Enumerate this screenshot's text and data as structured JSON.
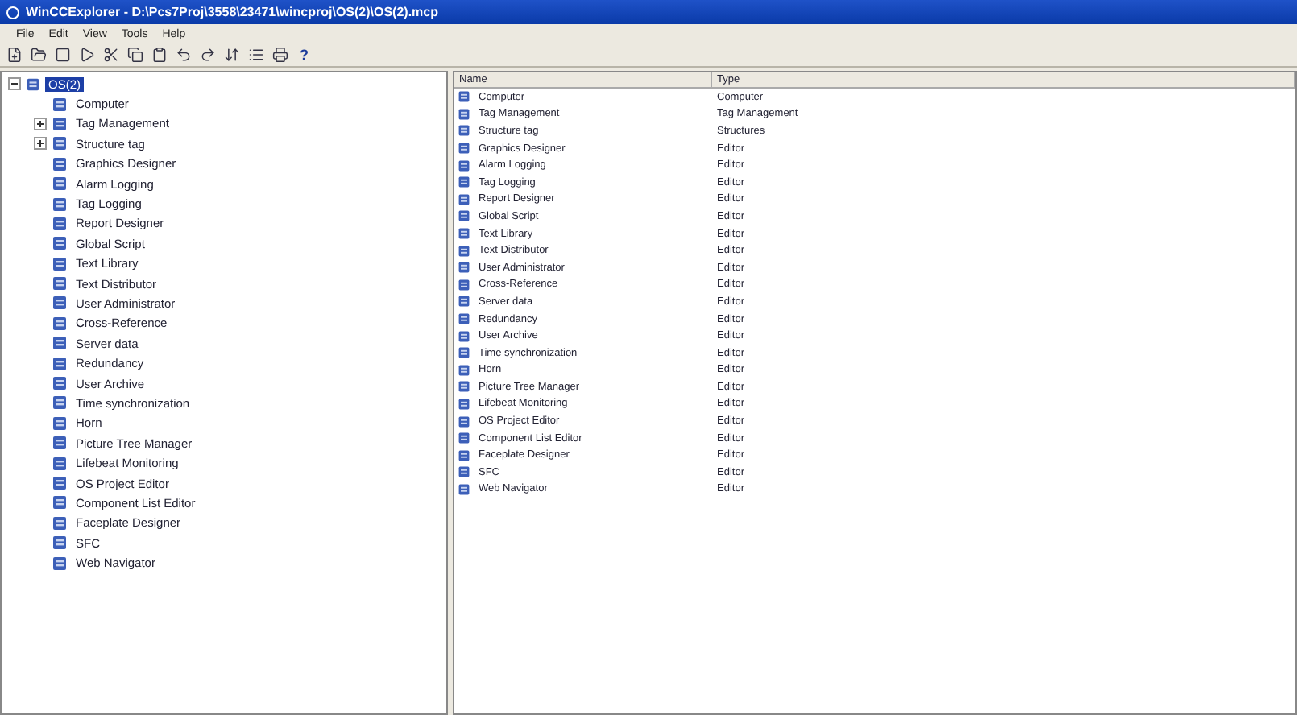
{
  "window": {
    "title": "WinCCExplorer - D:\\Pcs7Proj\\3558\\23471\\wincproj\\OS(2)\\OS(2).mcp"
  },
  "menu": [
    "File",
    "Edit",
    "View",
    "Tools",
    "Help"
  ],
  "help_button": "?",
  "tree": {
    "label": "OS(2)",
    "selected": true,
    "expanded": true,
    "children": [
      {
        "label": "Computer",
        "kind": "leaf"
      },
      {
        "label": "Tag Management",
        "kind": "folder",
        "expanded": false
      },
      {
        "label": "Structure tag",
        "kind": "folder",
        "expanded": false
      },
      {
        "label": "Graphics Designer",
        "kind": "leaf"
      },
      {
        "label": "Alarm Logging",
        "kind": "leaf"
      },
      {
        "label": "Tag Logging",
        "kind": "leaf"
      },
      {
        "label": "Report Designer",
        "kind": "leaf"
      },
      {
        "label": "Global Script",
        "kind": "leaf"
      },
      {
        "label": "Text Library",
        "kind": "leaf"
      },
      {
        "label": "Text Distributor",
        "kind": "leaf"
      },
      {
        "label": "User Administrator",
        "kind": "leaf"
      },
      {
        "label": "Cross-Reference",
        "kind": "leaf"
      },
      {
        "label": "Server data",
        "kind": "leaf"
      },
      {
        "label": "Redundancy",
        "kind": "leaf"
      },
      {
        "label": "User Archive",
        "kind": "leaf"
      },
      {
        "label": "Time synchronization",
        "kind": "leaf"
      },
      {
        "label": "Horn",
        "kind": "leaf"
      },
      {
        "label": "Picture Tree Manager",
        "kind": "leaf"
      },
      {
        "label": "Lifebeat Monitoring",
        "kind": "leaf"
      },
      {
        "label": "OS Project Editor",
        "kind": "leaf"
      },
      {
        "label": "Component List Editor",
        "kind": "leaf"
      },
      {
        "label": "Faceplate Designer",
        "kind": "leaf"
      },
      {
        "label": "SFC",
        "kind": "leaf"
      },
      {
        "label": "Web Navigator",
        "kind": "leaf"
      }
    ]
  },
  "table": {
    "columns": [
      "Name",
      "Type"
    ],
    "rows": [
      [
        "Computer",
        "Computer"
      ],
      [
        "Tag Management",
        "Tag Management"
      ],
      [
        "Structure tag",
        "Structures"
      ],
      [
        "Graphics Designer",
        "Editor"
      ],
      [
        "Alarm Logging",
        "Editor"
      ],
      [
        "Tag Logging",
        "Editor"
      ],
      [
        "Report Designer",
        "Editor"
      ],
      [
        "Global Script",
        "Editor"
      ],
      [
        "Text Library",
        "Editor"
      ],
      [
        "Text Distributor",
        "Editor"
      ],
      [
        "User Administrator",
        "Editor"
      ],
      [
        "Cross-Reference",
        "Editor"
      ],
      [
        "Server data",
        "Editor"
      ],
      [
        "Redundancy",
        "Editor"
      ],
      [
        "User Archive",
        "Editor"
      ],
      [
        "Time synchronization",
        "Editor"
      ],
      [
        "Horn",
        "Editor"
      ],
      [
        "Picture Tree Manager",
        "Editor"
      ],
      [
        "Lifebeat Monitoring",
        "Editor"
      ],
      [
        "OS Project Editor",
        "Editor"
      ],
      [
        "Component List Editor",
        "Editor"
      ],
      [
        "Faceplate Designer",
        "Editor"
      ],
      [
        "SFC",
        "Editor"
      ],
      [
        "Web Navigator",
        "Editor"
      ]
    ]
  }
}
